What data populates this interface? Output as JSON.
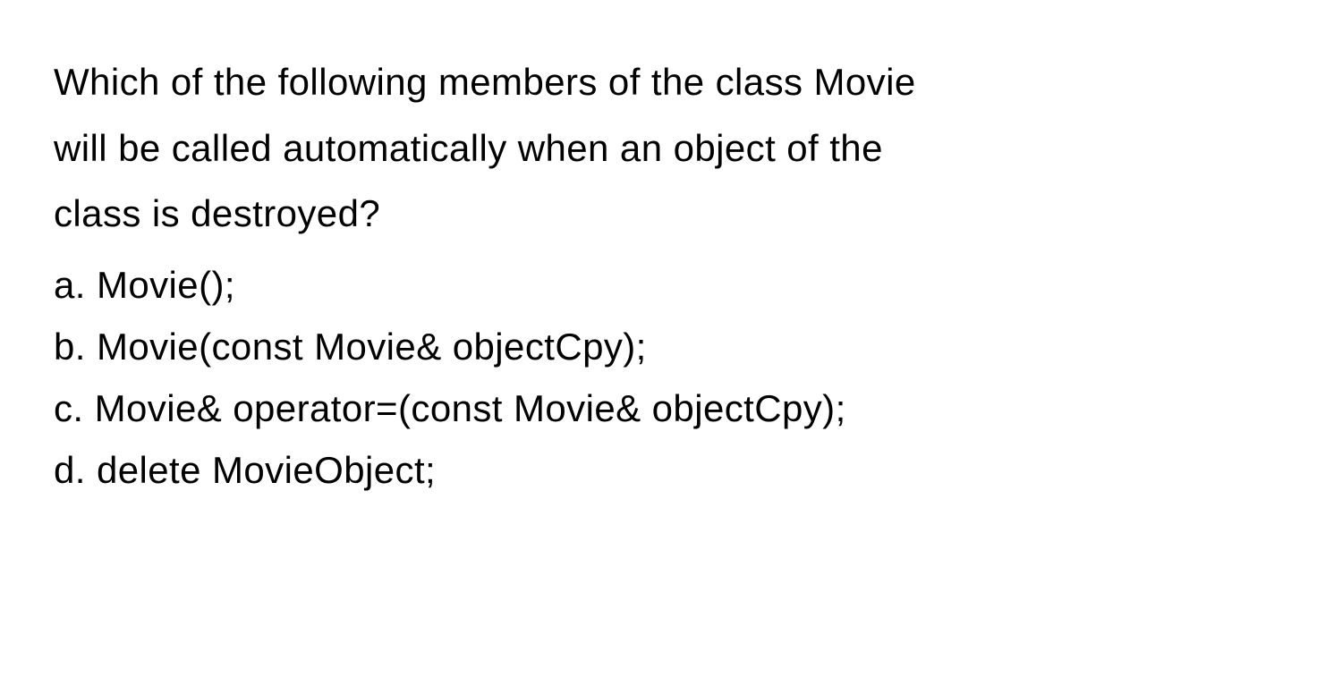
{
  "question": {
    "line1": "Which of the following members of the class Movie",
    "line2": "will be called automatically when an object of the",
    "line3": "class is destroyed?"
  },
  "options": {
    "a": "a. Movie();",
    "b": "b. Movie(const Movie& objectCpy);",
    "c": "c. Movie& operator=(const Movie& objectCpy);",
    "d": "d. delete MovieObject;"
  }
}
